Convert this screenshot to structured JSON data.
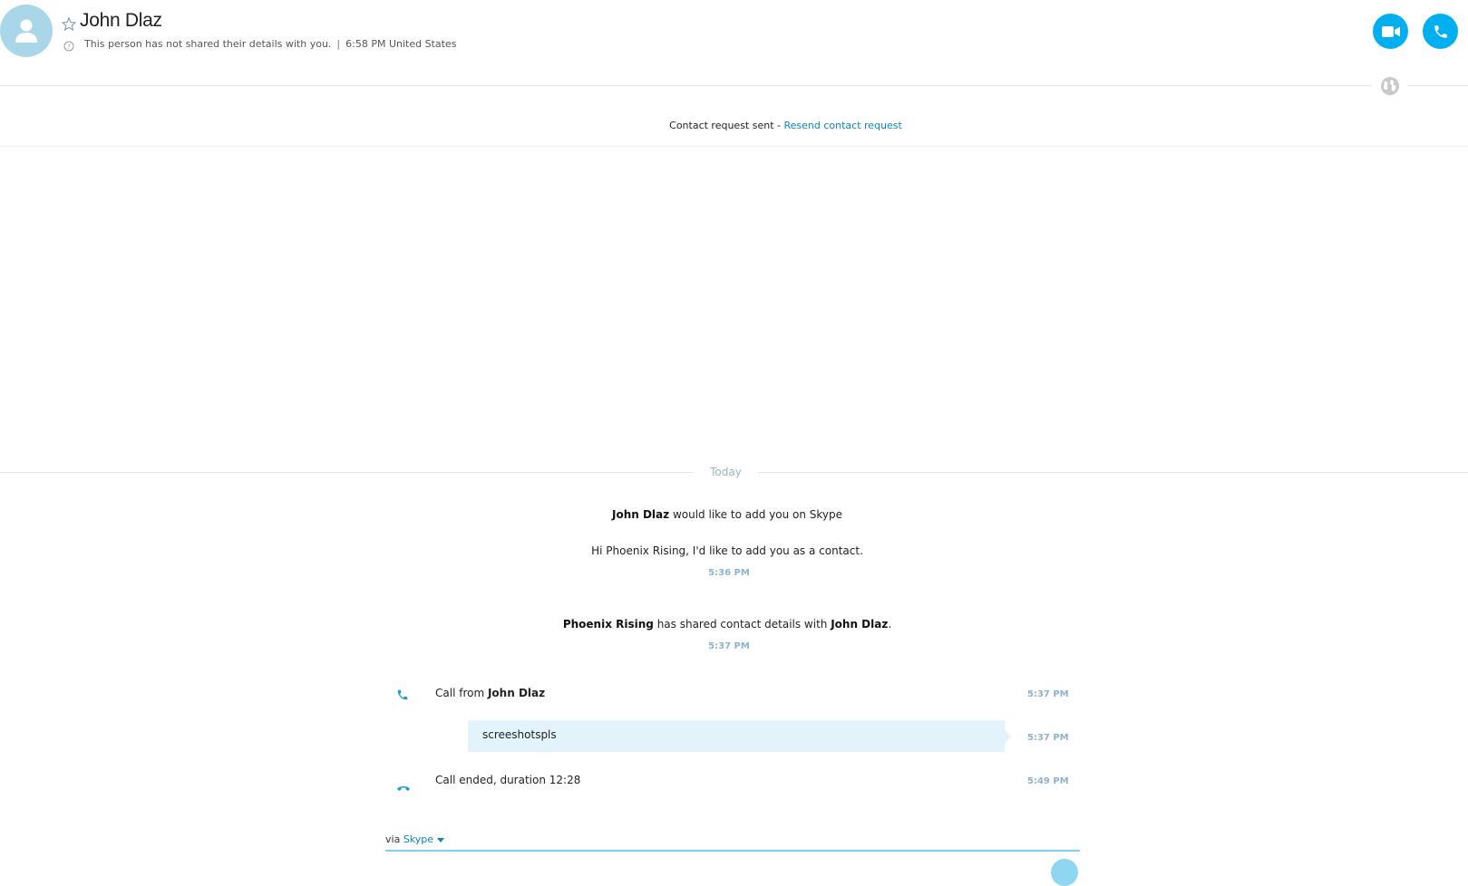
{
  "header": {
    "contact_name": "John Dlaz",
    "details_note": "This person has not shared their details with you.",
    "separator": "|",
    "local_time": "6:58 PM United States"
  },
  "request_bar": {
    "sent_text": "Contact request sent - ",
    "resend_link": "Resend contact request"
  },
  "conversation": {
    "date_divider": "Today",
    "add_request": {
      "sender": "John Dlaz",
      "action": " would like to add you on Skype",
      "message": "Hi Phoenix Rising, I'd like to add you as a contact.",
      "time": "5:36 PM"
    },
    "shared_details": {
      "who": "Phoenix Rising",
      "middle": " has shared contact details with ",
      "with": "John Dlaz",
      "end": ".",
      "time": "5:37 PM"
    },
    "call_from": {
      "prefix": "Call from ",
      "caller": "John Dlaz",
      "time": "5:37 PM"
    },
    "message_bubble": {
      "text": "screeshotspls",
      "time": "5:37 PM"
    },
    "call_ended": {
      "text": "Call ended, duration ",
      "duration": "12:28",
      "time": "5:49 PM"
    }
  },
  "compose": {
    "via_label": "via ",
    "service": "Skype"
  },
  "colors": {
    "accent": "#00aff0",
    "link": "#0a84c3",
    "timestamp": "#8db3cd",
    "bubble": "#e3f3fb",
    "avatar": "#a9d7e9"
  },
  "icons": [
    "avatar-person-icon",
    "star-icon",
    "info-icon",
    "video-call-icon",
    "audio-call-icon",
    "globe-icon",
    "incoming-call-icon",
    "call-ended-icon"
  ]
}
